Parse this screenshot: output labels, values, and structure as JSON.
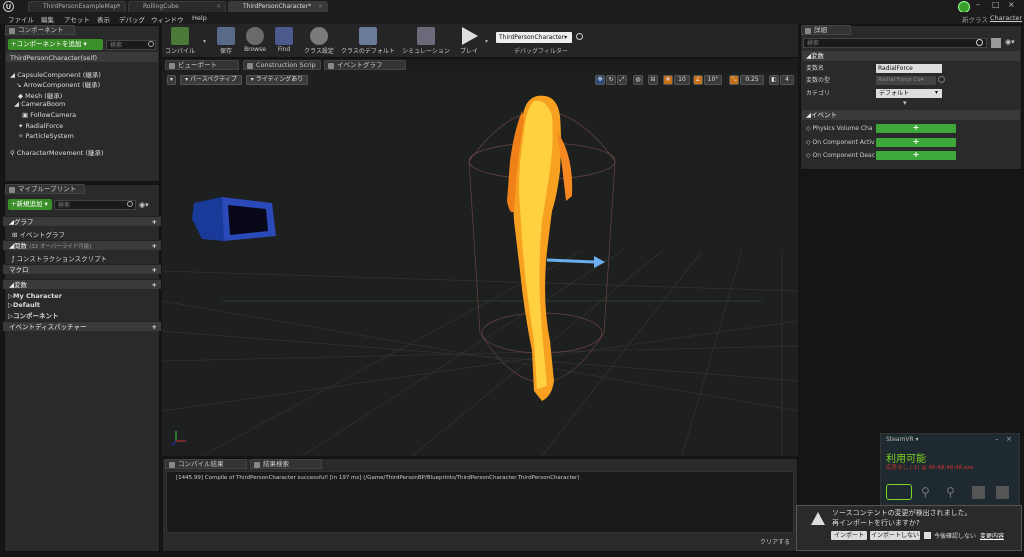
{
  "window_tabs": [
    {
      "label": "ThirdPersonExampleMap*"
    },
    {
      "label": "RollingCube"
    },
    {
      "label": "ThirdPersonCharacter*"
    }
  ],
  "window": {
    "project_label": "新クラス",
    "project_name": "Character"
  },
  "menu": [
    "ファイル",
    "編集",
    "アセット",
    "表示",
    "デバッグ",
    "ウィンドウ",
    "Help"
  ],
  "components_panel": {
    "tab": "コンポーネント",
    "add_button": "+コンポーネントを追加 ▾",
    "search_placeholder": "検索",
    "items": [
      "ThirdPersonCharacter(self)",
      "CapsuleComponent (継承)",
      "ArrowComponent (継承)",
      "Mesh (継承)",
      "CameraBoom",
      "FollowCamera",
      "RadialForce",
      "ParticleSystem",
      "CharacterMovement (継承)"
    ]
  },
  "mybp_panel": {
    "tab": "マイブループリント",
    "add_button": "+新規追加 ▾",
    "search_placeholder": "検索",
    "graph_header": "グラフ",
    "event_graph": "イベントグラフ",
    "functions_header": "関数",
    "functions_sub": "(32 オーバーライド可能)",
    "construction": "コンストラクションスクリプト",
    "macros_header": "マクロ",
    "variables_header": "変数",
    "var_items": [
      "My Character",
      "Default",
      "コンポーネント"
    ],
    "dispatchers_header": "イベントディスパッチャー"
  },
  "toolbar": {
    "buttons": [
      {
        "label": "コンパイル",
        "color": "#4a7a3a"
      },
      {
        "label": "保存",
        "color": "#5a6a8a"
      },
      {
        "label": "Browse",
        "color": "#6a6a6a"
      },
      {
        "label": "Find",
        "color": "#6a6a6a"
      },
      {
        "label": "クラス設定",
        "color": "#7a7a7a"
      },
      {
        "label": "クラスのデフォルト",
        "color": "#6a7a9a"
      },
      {
        "label": "シミュレーション",
        "color": "#6a6a7a"
      },
      {
        "label": "プレイ",
        "color": "#6a6a6a"
      }
    ],
    "debug_select": "ThirdPersonCharacter▾",
    "debug_filter": "デバッグフィルター"
  },
  "editor_tabs": [
    {
      "label": "ビューポート"
    },
    {
      "label": "Construction Scrip"
    },
    {
      "label": "イベントグラフ"
    }
  ],
  "viewport": {
    "perspective_btn": "パースペクティブ",
    "lighting_btn": "ライティングあり",
    "grid_snap": "10",
    "rot_snap": "10°",
    "scale_snap": "0.25",
    "camera_speed": "4"
  },
  "details_panel": {
    "tab": "詳細",
    "search_placeholder": "検索",
    "variable_header": "変数",
    "rows": [
      {
        "label": "変数名",
        "value": "RadialForce"
      },
      {
        "label": "変数の型",
        "value": "Radial Force Co▾"
      },
      {
        "label": "カテゴリ",
        "value": "デフォルト"
      }
    ],
    "event_header": "イベント",
    "events": [
      "Physics Volume Cha",
      "On Component Activ",
      "On Component Deac"
    ],
    "event_btn": "+"
  },
  "bottom_tabs": [
    {
      "label": "コンパイル結果"
    },
    {
      "label": "結果検索"
    }
  ],
  "compile_log": "[1445.99] Compile of ThirdPersonCharacter successful! [in 197 ms] (/Game/ThirdPersonBP/Blueprints/ThirdPersonCharacter.ThirdPersonCharacter)",
  "clear_btn": "クリアする",
  "steamvr": {
    "title": "SteamVR ▾",
    "status": "利用可能",
    "error": "応答なし (-1) @ 48:48:48:48.exe"
  },
  "notification": {
    "message_line1": "ソースコンテントの変更が検出されました。",
    "message_line2": "再インポートを行いますか?",
    "import": "インポート",
    "no_import": "インポートしない",
    "dont_ask": "今後確認しない",
    "changes": "変更内容"
  },
  "colors": {
    "accent_green": "#3a8f28",
    "event_green": "#3fa83a",
    "panel_bg": "#2a2a2a",
    "viewport_bg": "#1e1f1f"
  }
}
